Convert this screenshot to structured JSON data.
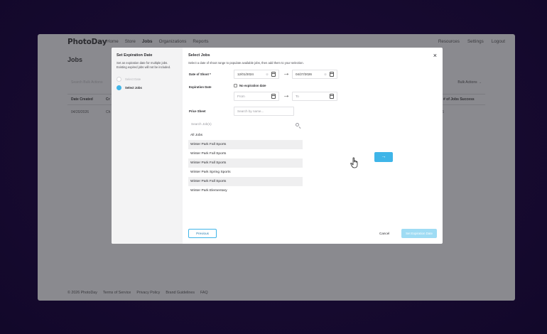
{
  "app": {
    "logo": "PhotoDay",
    "nav": [
      "Home",
      "Store",
      "Jobs",
      "Organizations",
      "Reports"
    ],
    "nav_active": "Jobs",
    "nav_right": [
      "Resources",
      "Settings",
      "Logout"
    ],
    "page_title": "Jobs",
    "search_placeholder": "Search Bulk Actions",
    "bulk_actions": "Bulk Actions →",
    "table": {
      "headers": [
        "Date Created",
        "Cr",
        "# of Jobs Success"
      ],
      "row": [
        "04/20/2026",
        "Ch",
        "6"
      ]
    },
    "footer": [
      "© 2026 PhotoDay",
      "Terms of Service",
      "Privacy Policy",
      "Brand Guidelines",
      "FAQ"
    ]
  },
  "modal": {
    "sidebar": {
      "title": "Set Expiration Date",
      "description": "Set an expiration date for multiple jobs. Existing expired jobs will not be included.",
      "steps": [
        {
          "label": "Select Date",
          "active": false
        },
        {
          "label": "Select Jobs",
          "active": true
        }
      ]
    },
    "main": {
      "title": "Select Jobs",
      "description": "Select a date of shoot range to populate available jobs, then add them to your selection.",
      "close_icon": "×",
      "date_of_shoot_label": "Date of Shoot *",
      "shoot_from": "12/01/2024",
      "shoot_to": "04/27/2026",
      "expiration_label": "Expiration Date",
      "no_expiration_label": "No expiration date",
      "exp_from_placeholder": "From",
      "exp_to_placeholder": "To",
      "price_sheet_label": "Price Sheet",
      "price_sheet_placeholder": "Search by name...",
      "jobs_search_placeholder": "Search Job(s)",
      "jobs": [
        {
          "name": "All Jobs",
          "selected": false
        },
        {
          "name": "Winter Park Fall Sports",
          "selected": true
        },
        {
          "name": "Winter Park Fall Sports",
          "selected": false
        },
        {
          "name": "Winter Park Fall Sports",
          "selected": true
        },
        {
          "name": "Winter Park Spring Sports",
          "selected": false
        },
        {
          "name": "Winter Park Fall Sports",
          "selected": true
        },
        {
          "name": "Winter Park Elementary",
          "selected": false
        }
      ],
      "move_icon": "→",
      "previous_label": "Previous",
      "cancel_label": "Cancel",
      "submit_label": "Set Expiration Date"
    }
  },
  "colors": {
    "accent": "#3fb5e8",
    "accent_disabled": "#9fdcf4",
    "backdrop": "#170a30"
  }
}
